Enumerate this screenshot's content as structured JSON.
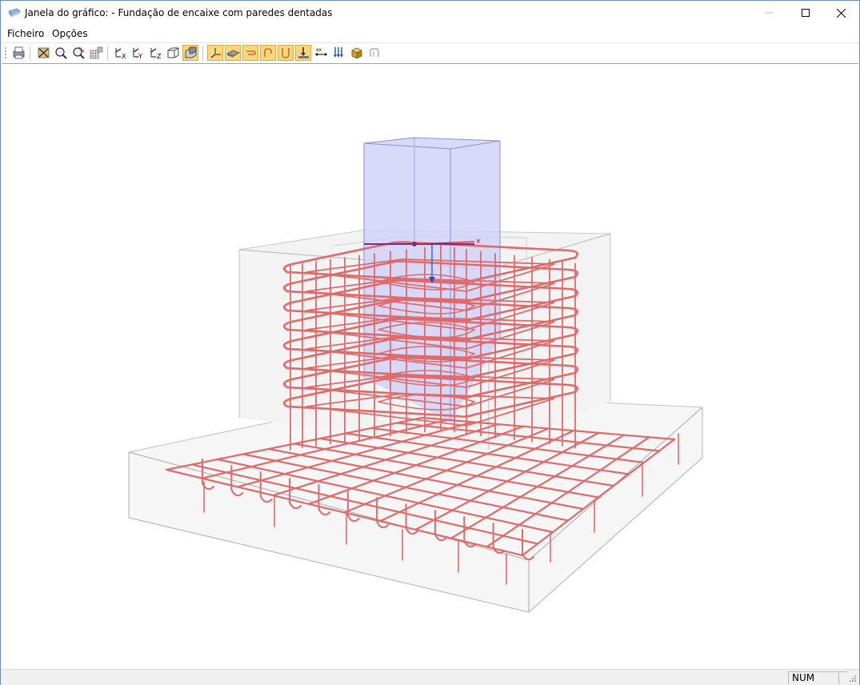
{
  "window": {
    "title": "Janela do gráfico: - Fundação de encaixe com paredes dentadas"
  },
  "menu": {
    "items": [
      "Ficheiro",
      "Opções"
    ]
  },
  "toolbar": {
    "buttons": [
      "print-icon",
      "properties-icon",
      "zoom-icon",
      "zoom-all-icon",
      "grid-icon",
      "view-x-icon",
      "view-minus-y-icon",
      "view-z-icon",
      "wireframe-icon",
      "solid-view-icon",
      "axes-icon",
      "plate-rebar-icon",
      "stirrup-icon",
      "hook-icon",
      "u-bar-icon",
      "anchor-icon",
      "dimension-icon",
      "loads-icon",
      "material-icon",
      "pin-icon"
    ],
    "active": [
      "solid-view-icon",
      "axes-icon",
      "plate-rebar-icon",
      "stirrup-icon",
      "hook-icon",
      "u-bar-icon",
      "anchor-icon"
    ]
  },
  "statusbar": {
    "num": "NUM"
  },
  "colors": {
    "rebar": "#e06a6a",
    "column": "#c9c9f6",
    "concrete_edge": "#a9a9a9",
    "toolbar_active": "#fbd77a"
  }
}
